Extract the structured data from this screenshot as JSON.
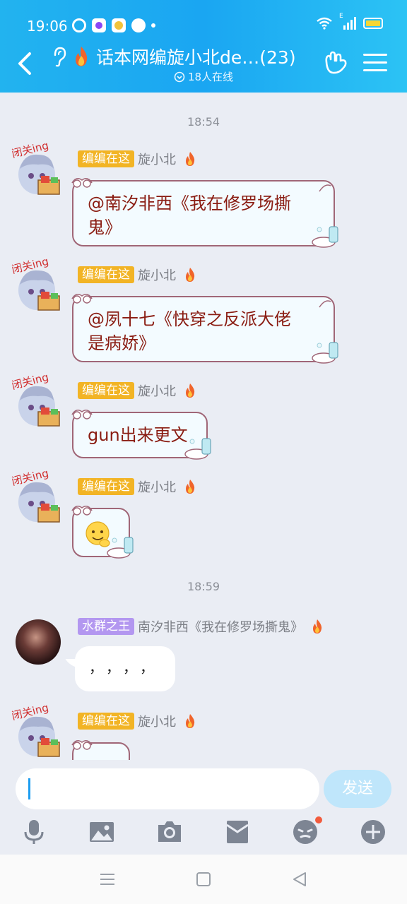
{
  "status_bar": {
    "time": "19:06",
    "signal_label": "E"
  },
  "header": {
    "title": "话本网编旋小北de…(23)",
    "online": "18人在线",
    "accent": "#1aa6f2"
  },
  "chat": {
    "time_separators": [
      "18:54",
      "18:59"
    ],
    "messages": [
      {
        "badge": "编编在这",
        "sender": "旋小北",
        "text_line1": "@南汐非西《我在修罗场撕",
        "text_line2": "鬼》"
      },
      {
        "badge": "编编在这",
        "sender": "旋小北",
        "text_line1": "@夙十七《快穿之反派大佬",
        "text_line2": "是病娇》"
      },
      {
        "badge": "编编在这",
        "sender": "旋小北",
        "text": "gun出来更文"
      },
      {
        "badge": "编编在这",
        "sender": "旋小北",
        "emoji": "sticker"
      },
      {
        "badge": "水群之王",
        "sender": "南汐非西《我在修罗场撕鬼》",
        "text": "，，，，"
      },
      {
        "badge": "编编在这",
        "sender": "旋小北"
      }
    ],
    "anime_avatar_caption": "闭关ing"
  },
  "composer": {
    "input_value": "",
    "send_label": "发送",
    "tools": [
      "microphone-icon",
      "image-icon",
      "camera-icon",
      "red-packet-icon",
      "emoji-icon",
      "plus-icon"
    ]
  },
  "navbar": {
    "buttons": [
      "menu-icon",
      "home-icon",
      "back-icon"
    ]
  }
}
